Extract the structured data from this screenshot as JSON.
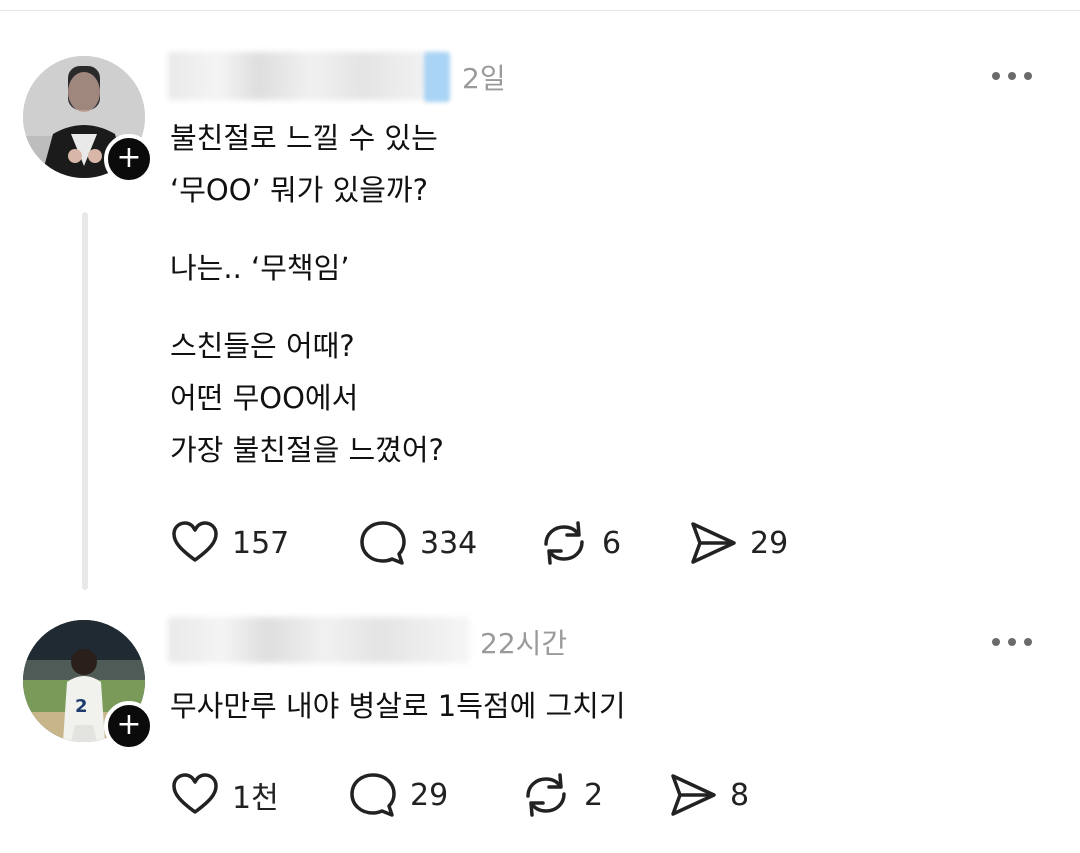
{
  "post1": {
    "time": "2일",
    "lines": [
      "불친절로 느낄 수 있는",
      "‘무OO’ 뭐가 있을까?",
      "",
      "나는.. ‘무책임’",
      "",
      "스친들은 어때?",
      "어떤 무OO에서",
      "가장 불친절을 느꼈어?"
    ],
    "actions": {
      "like": "157",
      "reply": "334",
      "repost": "6",
      "share": "29"
    }
  },
  "post2": {
    "time": "22시간",
    "text": "무사만루 내야 병살로 1득점에 그치기",
    "actions": {
      "like": "1천",
      "reply": "29",
      "repost": "2",
      "share": "8"
    }
  },
  "icons": {
    "like": "heart-icon",
    "reply": "speech-bubble-icon",
    "repost": "repost-arrows-icon",
    "share": "send-icon",
    "more": "more-dots-icon",
    "follow": "plus-icon"
  },
  "colors": {
    "text": "#111111",
    "muted": "#9a9a9a",
    "badge": "#0b0b0b",
    "thread_line": "#e8e8e8"
  }
}
